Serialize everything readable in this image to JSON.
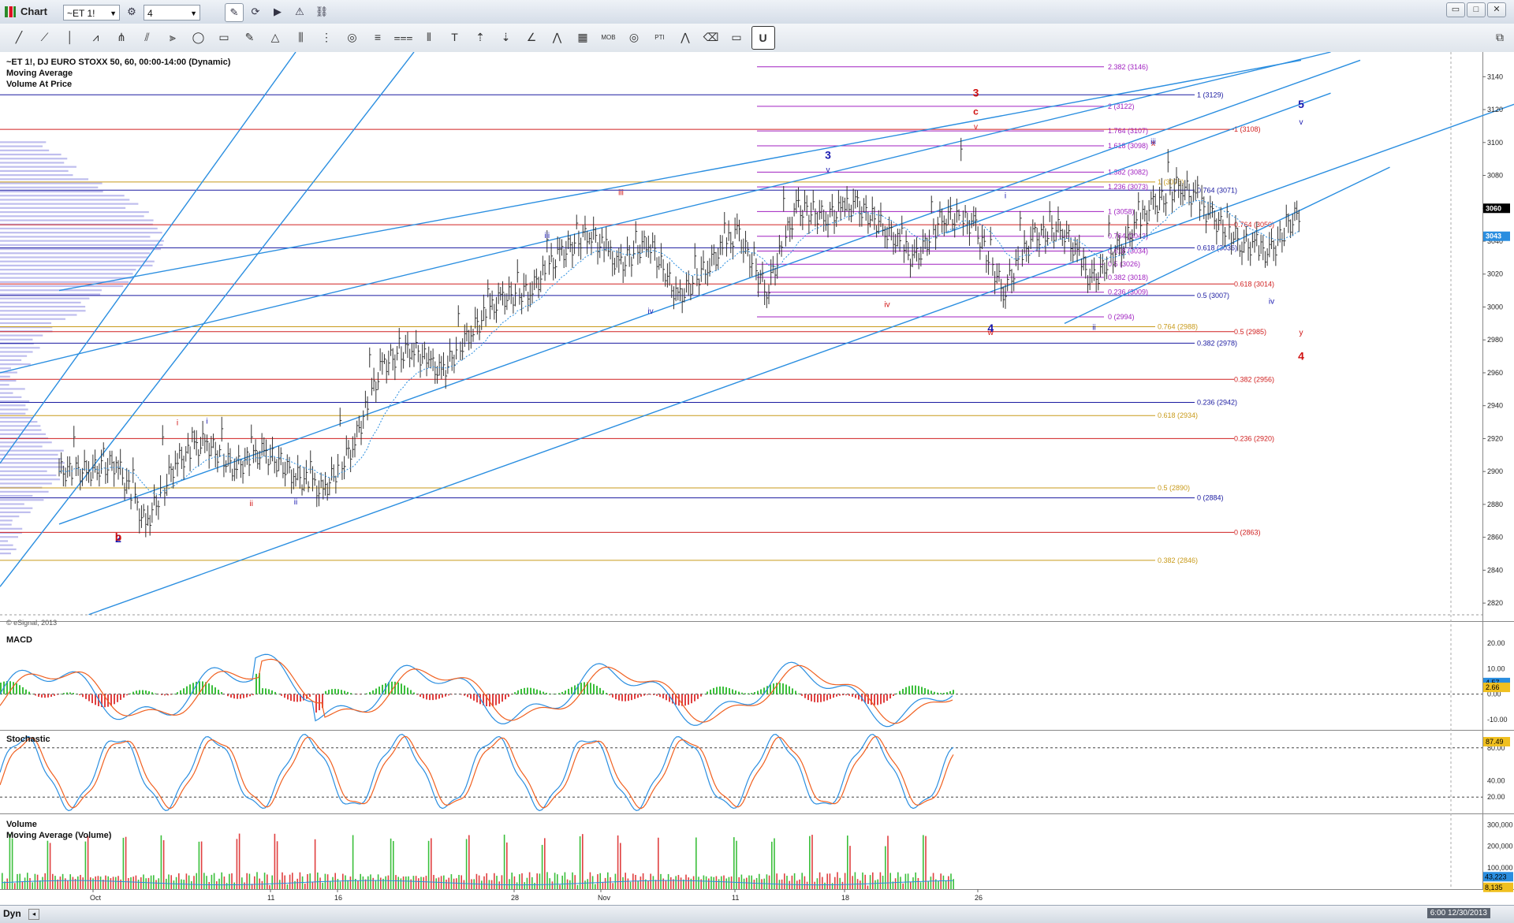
{
  "window": {
    "title": "Chart",
    "symbol_input": "~ET 1!",
    "interval_input": "4",
    "controls": [
      "restore",
      "maximize",
      "close"
    ]
  },
  "toolbar": {
    "tools": [
      "line-tool-icon",
      "ray-tool-icon",
      "vertical-line-icon",
      "wave-tool-icon",
      "pitchfork-icon",
      "fib-fan-icon",
      "gann-fan-icon",
      "ellipse-icon",
      "rectangle-icon",
      "pencil-icon",
      "triangle-icon",
      "parallel-channel-icon",
      "regression-channel-icon",
      "spiral-icon",
      "fib-retracement-icon",
      "fib-extension-icon",
      "cycle-lines-icon",
      "text-tool-icon",
      "arrow-up-icon",
      "arrow-down-icon",
      "angle-icon",
      "trend-angle-icon",
      "table-icon",
      "mob-icon",
      "mmo-icon",
      "pti-icon",
      "elliott-icon",
      "eraser-icon",
      "comment-icon",
      "magnet-icon"
    ],
    "labels": {
      "mob": "MOB",
      "pti": "PTI"
    }
  },
  "legend": {
    "line1": "~ET 1!, DJ EURO STOXX 50, 60, 00:00-14:00 (Dynamic)",
    "line2": "Moving Average",
    "line3": "Volume At Price",
    "copyright": "© eSignal, 2013"
  },
  "panes": {
    "macd": "MACD",
    "stochastic": "Stochastic",
    "volume": "Volume",
    "volume_ma": "Moving Average (Volume)"
  },
  "price_axis": {
    "ticks": [
      "3140",
      "3120",
      "3100",
      "3080",
      "3060",
      "3040",
      "3020",
      "3000",
      "2980",
      "2960",
      "2940",
      "2920",
      "2900",
      "2880",
      "2860",
      "2840",
      "2820"
    ],
    "current_price": "3060",
    "ma_price": "3043"
  },
  "macd_axis": {
    "ticks": [
      "20.00",
      "10.00",
      "0.00",
      "-10.00"
    ],
    "badges": [
      "4.57",
      "2.66"
    ]
  },
  "stoch_axis": {
    "ticks": [
      "80.00",
      "40.00",
      "20.00"
    ],
    "badges": [
      "87.49"
    ]
  },
  "volume_axis": {
    "ticks": [
      "300,000",
      "200,000",
      "100,000"
    ],
    "badges": [
      "43,223",
      "8,135"
    ]
  },
  "time_axis": {
    "labels": [
      "Oct",
      "11",
      "16",
      "28",
      "Nov",
      "11",
      "18",
      "26"
    ]
  },
  "status": {
    "mode": "Dyn",
    "datetime": "6:00 12/30/2013"
  },
  "fib_sets": [
    {
      "color": "#d02020",
      "levels": [
        {
          "label": "1 (3108)",
          "price": 3108
        },
        {
          "label": "0.764 (3050)",
          "price": 3050
        },
        {
          "label": "0.618 (3014)",
          "price": 3014
        },
        {
          "label": "0.5 (2985)",
          "price": 2985
        },
        {
          "label": "0.382 (2956)",
          "price": 2956
        },
        {
          "label": "0.236 (2920)",
          "price": 2920
        },
        {
          "label": "0 (2863)",
          "price": 2863
        }
      ]
    },
    {
      "color": "#1a1aa0",
      "levels": [
        {
          "label": "1 (3129)",
          "price": 3129
        },
        {
          "label": "0.764 (3071)",
          "price": 3071
        },
        {
          "label": "0.618 (3036)",
          "price": 3036
        },
        {
          "label": "0.5 (3007)",
          "price": 3007
        },
        {
          "label": "0.382 (2978)",
          "price": 2978
        },
        {
          "label": "0.236 (2942)",
          "price": 2942
        },
        {
          "label": "0 (2884)",
          "price": 2884
        }
      ]
    },
    {
      "color": "#c89a1a",
      "levels": [
        {
          "label": "1 (3076)",
          "price": 3076
        },
        {
          "label": "0.764 (2988)",
          "price": 2988
        },
        {
          "label": "0.618 (2934)",
          "price": 2934
        },
        {
          "label": "0.5 (2890)",
          "price": 2890
        },
        {
          "label": "0.382 (2846)",
          "price": 2846
        }
      ]
    },
    {
      "color": "#a020c0",
      "levels": [
        {
          "label": "2.382 (3146)",
          "price": 3146
        },
        {
          "label": "2 (3122)",
          "price": 3122
        },
        {
          "label": "1.764 (3107)",
          "price": 3107
        },
        {
          "label": "1.618 (3098)",
          "price": 3098
        },
        {
          "label": "1.382 (3082)",
          "price": 3082
        },
        {
          "label": "1.236 (3073)",
          "price": 3073
        },
        {
          "label": "1 (3058)",
          "price": 3058
        },
        {
          "label": "0.764 (3043)",
          "price": 3043
        },
        {
          "label": "0.618 (3034)",
          "price": 3034
        },
        {
          "label": "0.5 (3026)",
          "price": 3026
        },
        {
          "label": "0.382 (3018)",
          "price": 3018
        },
        {
          "label": "0.236 (3009)",
          "price": 3009
        },
        {
          "label": "0 (2994)",
          "price": 2994
        }
      ]
    }
  ],
  "wave_labels": [
    {
      "text": "3",
      "color": "#d01010",
      "size": "big",
      "date": "2013-11-08",
      "price": 3128
    },
    {
      "text": "c",
      "color": "#d01010",
      "size": "mid",
      "date": "2013-11-08",
      "price": 3117
    },
    {
      "text": "v",
      "color": "#d01010",
      "size": "small",
      "date": "2013-11-08",
      "price": 3108
    },
    {
      "text": "3",
      "color": "#1a1ab0",
      "size": "big",
      "date": "2013-11-01",
      "price": 3090
    },
    {
      "text": "v",
      "color": "#1a1ab0",
      "size": "small",
      "date": "2013-11-01",
      "price": 3082
    },
    {
      "text": "5",
      "color": "#1a1ab0",
      "size": "big",
      "date": "2013-11-25",
      "price": 3121
    },
    {
      "text": "v",
      "color": "#1a1ab0",
      "size": "small",
      "date": "2013-11-25",
      "price": 3111
    },
    {
      "text": "iii",
      "color": "#d01010",
      "size": "small",
      "date": "2013-10-23",
      "price": 3068
    },
    {
      "text": "iii",
      "color": "#1a1ab0",
      "size": "small",
      "date": "2013-10-20",
      "price": 3042
    },
    {
      "text": "iv",
      "color": "#1a1ab0",
      "size": "small",
      "date": "2013-10-24",
      "price": 2996
    },
    {
      "text": "iv",
      "color": "#d01010",
      "size": "small",
      "date": "2013-11-05",
      "price": 3000
    },
    {
      "text": "w",
      "color": "#d01010",
      "size": "small",
      "date": "2013-11-09",
      "price": 2983
    },
    {
      "text": "4",
      "color": "#1a1ab0",
      "size": "big",
      "date": "2013-11-09",
      "price": 2985
    },
    {
      "text": "i",
      "color": "#1a1ab0",
      "size": "small",
      "date": "2013-11-11",
      "price": 3066
    },
    {
      "text": "ii",
      "color": "#1a1ab0",
      "size": "small",
      "date": "2013-11-14",
      "price": 2986
    },
    {
      "text": "x",
      "color": "#d01010",
      "size": "small",
      "date": "2013-11-18",
      "price": 3098
    },
    {
      "text": "iii",
      "color": "#1a1ab0",
      "size": "small",
      "date": "2013-11-18",
      "price": 3099
    },
    {
      "text": "iv",
      "color": "#1a1ab0",
      "size": "small",
      "date": "2013-11-22",
      "price": 3002
    },
    {
      "text": "y",
      "color": "#d01010",
      "size": "small",
      "date": "2013-11-25",
      "price": 2983
    },
    {
      "text": "4",
      "color": "#d01010",
      "size": "big",
      "date": "2013-11-25",
      "price": 2968
    },
    {
      "text": "i",
      "color": "#d01010",
      "size": "small",
      "date": "2013-10-02",
      "price": 2928
    },
    {
      "text": "i",
      "color": "#1a1ab0",
      "size": "small",
      "date": "2013-10-03",
      "price": 2929
    },
    {
      "text": "ii",
      "color": "#d01010",
      "size": "small",
      "date": "2013-10-06",
      "price": 2879
    },
    {
      "text": "ii",
      "color": "#1a1ab0",
      "size": "small",
      "date": "2013-10-08",
      "price": 2880
    },
    {
      "text": "2",
      "color": "#1a1ab0",
      "size": "big",
      "date": "2013-09-30",
      "price": 2857
    },
    {
      "text": "b",
      "color": "#d01010",
      "size": "big",
      "date": "2013-09-30",
      "price": 2858
    }
  ],
  "chart_data": {
    "type": "ohlc-bar",
    "title": "~ET 1!, DJ EURO STOXX 50, 60, 00:00-14:00 (Dynamic)",
    "indicators": [
      "Moving Average",
      "Volume At Price",
      "MACD",
      "Stochastic",
      "Volume",
      "Moving Average (Volume)"
    ],
    "ylim": [
      2810,
      3155
    ],
    "series": [
      {
        "name": "~ET 1!",
        "x": [
          "2013-09-26",
          "2013-09-27",
          "2013-09-30",
          "2013-10-01",
          "2013-10-02",
          "2013-10-03",
          "2013-10-04",
          "2013-10-07",
          "2013-10-08",
          "2013-10-09",
          "2013-10-10",
          "2013-10-11",
          "2013-10-14",
          "2013-10-15",
          "2013-10-16",
          "2013-10-17",
          "2013-10-18",
          "2013-10-21",
          "2013-10-22",
          "2013-10-23",
          "2013-10-24",
          "2013-10-25",
          "2013-10-28",
          "2013-10-29",
          "2013-10-30",
          "2013-10-31",
          "2013-11-01",
          "2013-11-04",
          "2013-11-05",
          "2013-11-06",
          "2013-11-07",
          "2013-11-08",
          "2013-11-11",
          "2013-11-12",
          "2013-11-13",
          "2013-11-14",
          "2013-11-15",
          "2013-11-18",
          "2013-11-19",
          "2013-11-20",
          "2013-11-21",
          "2013-11-22"
        ],
        "close": [
          2900,
          2905,
          2868,
          2905,
          2918,
          2902,
          2912,
          2898,
          2888,
          2915,
          2965,
          2975,
          2960,
          2985,
          3005,
          3010,
          3032,
          3045,
          3025,
          3040,
          3005,
          3025,
          3045,
          3010,
          3060,
          3055,
          3062,
          3048,
          3028,
          3056,
          3050,
          3010,
          3042,
          3048,
          3015,
          3038,
          3060,
          3075,
          3055,
          3040,
          3032,
          3058
        ],
        "high": [
          2925,
          2918,
          2905,
          2925,
          2928,
          2930,
          2925,
          2915,
          2910,
          2935,
          2975,
          2985,
          2972,
          3000,
          3015,
          3025,
          3045,
          3055,
          3045,
          3050,
          3020,
          3035,
          3055,
          3040,
          3070,
          3068,
          3068,
          3060,
          3052,
          3068,
          3100,
          3045,
          3058,
          3062,
          3040,
          3055,
          3068,
          3092,
          3078,
          3062,
          3048,
          3060
        ]
      }
    ],
    "channels": [
      {
        "from": [
          "2013-09-26",
          2868
        ],
        "to": [
          "2013-11-27",
          3150
        ]
      },
      {
        "from": [
          "2013-09-26",
          3010
        ],
        "to": [
          "2013-11-25",
          3150
        ]
      },
      {
        "from": [
          "2013-09-27",
          2813
        ],
        "to": [
          "2013-12-07",
          3138
        ]
      }
    ]
  }
}
